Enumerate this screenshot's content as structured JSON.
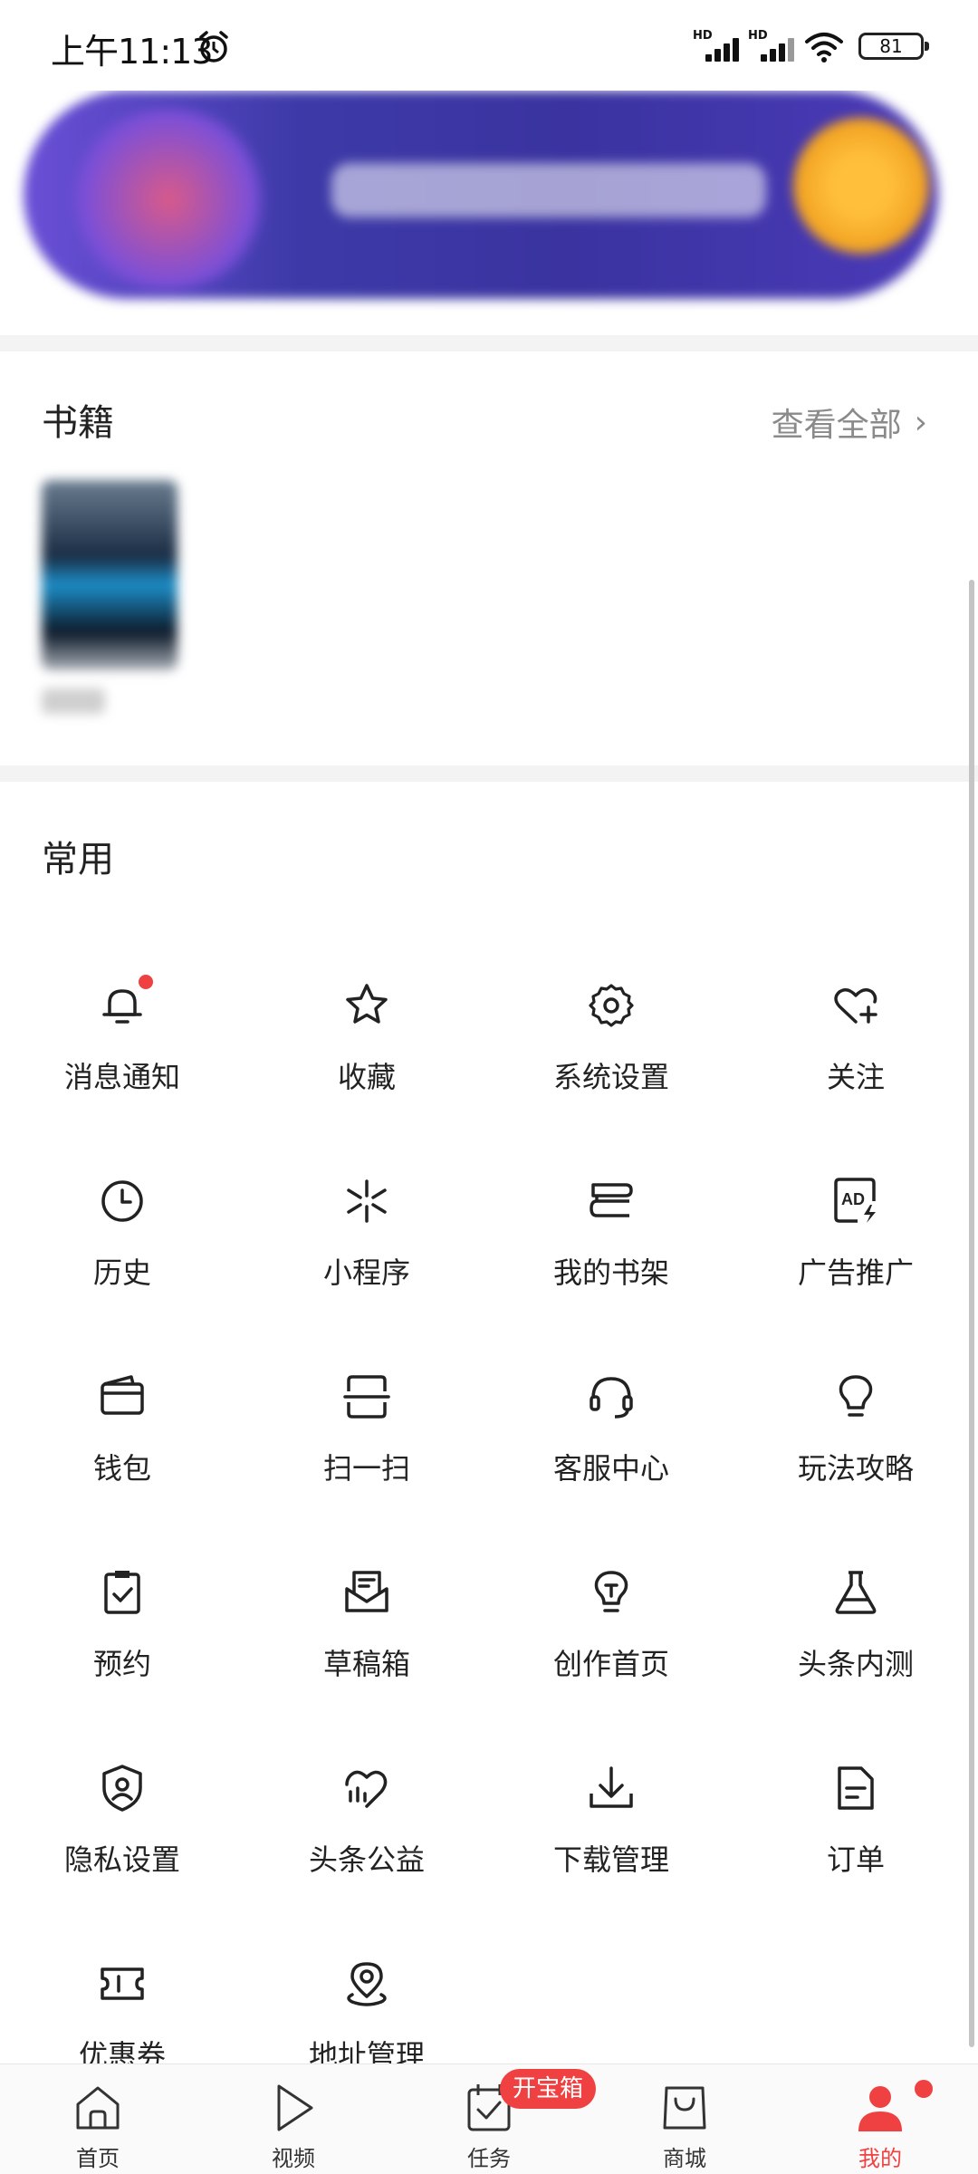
{
  "status_bar": {
    "time": "上午11:13",
    "signal_1": "HD",
    "signal_2": "HD",
    "battery": "81"
  },
  "books": {
    "title": "书籍",
    "view_all": "查看全部"
  },
  "common": {
    "title": "常用",
    "items": [
      {
        "label": "消息通知",
        "icon": "bell-icon",
        "has_dot": true
      },
      {
        "label": "收藏",
        "icon": "star-icon"
      },
      {
        "label": "系统设置",
        "icon": "gear-icon"
      },
      {
        "label": "关注",
        "icon": "heart-plus-icon"
      },
      {
        "label": "历史",
        "icon": "clock-icon"
      },
      {
        "label": "小程序",
        "icon": "mini-program-icon"
      },
      {
        "label": "我的书架",
        "icon": "bookshelf-icon"
      },
      {
        "label": "广告推广",
        "icon": "ad-icon"
      },
      {
        "label": "钱包",
        "icon": "wallet-icon"
      },
      {
        "label": "扫一扫",
        "icon": "scan-icon"
      },
      {
        "label": "客服中心",
        "icon": "headset-icon"
      },
      {
        "label": "玩法攻略",
        "icon": "lightbulb-icon"
      },
      {
        "label": "预约",
        "icon": "clipboard-check-icon"
      },
      {
        "label": "草稿箱",
        "icon": "draft-box-icon"
      },
      {
        "label": "创作首页",
        "icon": "create-bulb-icon"
      },
      {
        "label": "头条内测",
        "icon": "flask-icon"
      },
      {
        "label": "隐私设置",
        "icon": "shield-user-icon"
      },
      {
        "label": "头条公益",
        "icon": "charity-heart-icon"
      },
      {
        "label": "下载管理",
        "icon": "download-icon"
      },
      {
        "label": "订单",
        "icon": "document-icon"
      },
      {
        "label": "优惠券",
        "icon": "coupon-icon"
      },
      {
        "label": "地址管理",
        "icon": "location-pin-icon"
      }
    ]
  },
  "bottom_nav": {
    "items": [
      {
        "label": "首页",
        "icon": "home-icon"
      },
      {
        "label": "视频",
        "icon": "play-icon"
      },
      {
        "label": "任务",
        "icon": "task-icon"
      },
      {
        "label": "商城",
        "icon": "shopping-bag-icon"
      },
      {
        "label": "我的",
        "icon": "profile-icon",
        "active": true
      }
    ],
    "task_badge": "开宝箱"
  },
  "colors": {
    "accent": "#f04142",
    "text": "#222222",
    "muted": "#8a8a8a"
  }
}
